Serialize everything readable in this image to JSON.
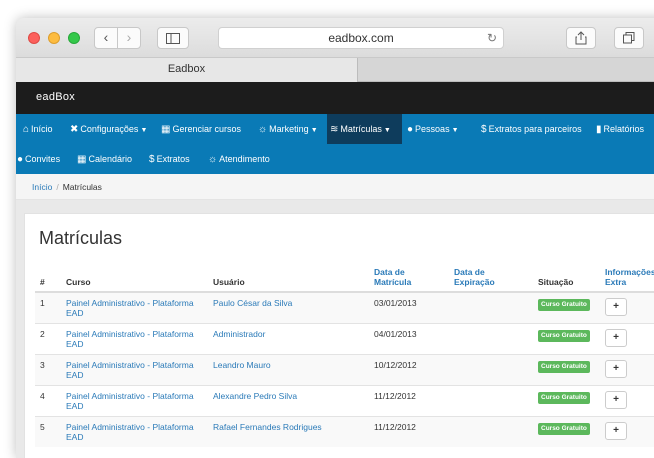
{
  "browser": {
    "url": "eadbox.com",
    "tab_title": "Eadbox",
    "back": "‹",
    "forward": "›"
  },
  "app": {
    "logo": "eadBox"
  },
  "menu": {
    "items": [
      {
        "label": "Início",
        "icon": "home-icon"
      },
      {
        "label": "Configurações",
        "icon": "wrench-icon"
      },
      {
        "label": "Gerenciar cursos",
        "icon": "courses-icon"
      },
      {
        "label": "Marketing",
        "icon": "lightbulb-icon"
      },
      {
        "label": "Matrículas",
        "icon": "layers-icon"
      },
      {
        "label": "Pessoas",
        "icon": "user-icon"
      },
      {
        "label": "Extratos para parceiros",
        "icon": "dollar-icon"
      },
      {
        "label": "Relatórios",
        "icon": "chart-icon"
      },
      {
        "label": "Convites",
        "icon": "users-icon"
      },
      {
        "label": "Calendário",
        "icon": "calendar-icon"
      },
      {
        "label": "Extratos",
        "icon": "dollar-icon"
      },
      {
        "label": "Atendimento",
        "icon": "lightbulb-icon"
      }
    ]
  },
  "breadcrumb": {
    "home": "Início",
    "separator": "/",
    "current": "Matrículas"
  },
  "page": {
    "title": "Matrículas"
  },
  "table": {
    "headers": {
      "num": "#",
      "curso": "Curso",
      "usuario": "Usuário",
      "data_matricula_1": "Data de",
      "data_matricula_2": "Matrícula",
      "data_expiracao_1": "Data de",
      "data_expiracao_2": "Expiração",
      "situacao": "Situação",
      "info_1": "Informações",
      "info_2": "Extra"
    },
    "rows": [
      {
        "num": "1",
        "curso": "Painel Administrativo - Plataforma EAD",
        "usuario": "Paulo César da Silva",
        "data": "03/01/2013",
        "expiracao": "",
        "situacao": "Curso Gratuito",
        "extra": "+"
      },
      {
        "num": "2",
        "curso": "Painel Administrativo - Plataforma EAD",
        "usuario": "Administrador",
        "data": "04/01/2013",
        "expiracao": "",
        "situacao": "Curso Gratuito",
        "extra": "+"
      },
      {
        "num": "3",
        "curso": "Painel Administrativo - Plataforma EAD",
        "usuario": "Leandro Mauro",
        "data": "10/12/2012",
        "expiracao": "",
        "situacao": "Curso Gratuito",
        "extra": "+"
      },
      {
        "num": "4",
        "curso": "Painel Administrativo - Plataforma EAD",
        "usuario": "Alexandre Pedro Silva",
        "data": "11/12/2012",
        "expiracao": "",
        "situacao": "Curso Gratuito",
        "extra": "+"
      },
      {
        "num": "5",
        "curso": "Painel Administrativo - Plataforma EAD",
        "usuario": "Rafael Fernandes Rodrigues",
        "data": "11/12/2012",
        "expiracao": "",
        "situacao": "Curso Gratuito",
        "extra": "+"
      }
    ]
  },
  "colors": {
    "menu_bg": "#0a7ab6",
    "menu_active": "#0e3c5c",
    "topbar": "#1c1c1c",
    "link": "#2a7ab8",
    "badge": "#5cb85c"
  }
}
